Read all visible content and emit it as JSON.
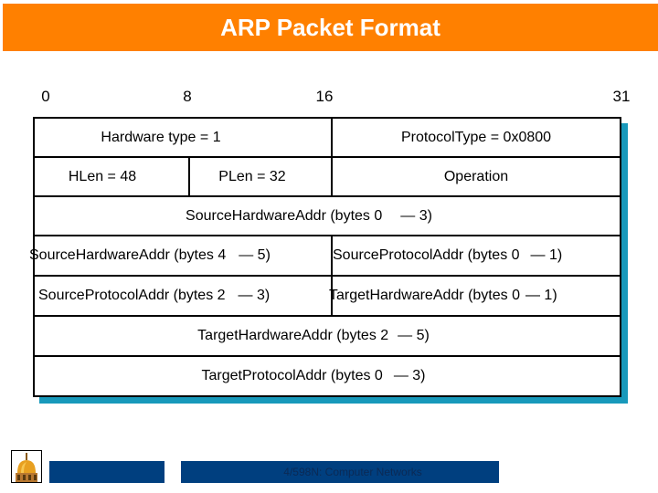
{
  "title": "ARP Packet Format",
  "bit_positions": [
    {
      "label": "0"
    },
    {
      "label": "8"
    },
    {
      "label": "16"
    },
    {
      "label": "31"
    }
  ],
  "rows": [
    {
      "cells": [
        {
          "text": "Hardware type = 1",
          "span_bits": 16
        },
        {
          "text": "ProtocolType = 0x0800",
          "span_bits": 16
        }
      ]
    },
    {
      "cells": [
        {
          "text": "HLen = 48",
          "span_bits": 8
        },
        {
          "text": "PLen = 32",
          "span_bits": 8
        },
        {
          "text": "Operation",
          "span_bits": 16
        }
      ]
    },
    {
      "cells": [
        {
          "text": "SourceHardwareAddr (bytes 0",
          "range_end": "— 3)",
          "span_bits": 32
        }
      ]
    },
    {
      "cells": [
        {
          "text": "SourceHardwareAddr (bytes 4",
          "range_end": "— 5)",
          "span_bits": 16
        },
        {
          "text": "SourceProtocolAddr (bytes 0",
          "range_end": "—  1)",
          "span_bits": 16
        }
      ]
    },
    {
      "cells": [
        {
          "text": "SourceProtocolAddr (bytes 2",
          "range_end": "— 3)",
          "span_bits": 16
        },
        {
          "text": "TargetHardwareAddr (bytes 0",
          "range_end": "— 1)",
          "span_bits": 16
        }
      ]
    },
    {
      "cells": [
        {
          "text": "TargetHardwareAddr (bytes 2",
          "range_end": "—  5)",
          "span_bits": 32
        }
      ]
    },
    {
      "cells": [
        {
          "text": "TargetProtocolAddr (bytes 0",
          "range_end": "— 3)",
          "span_bits": 32
        }
      ]
    }
  ],
  "colors": {
    "title_bar": "#ff8000",
    "shadow": "#1899bb",
    "footer_bar": "#003f7f"
  },
  "footer": {
    "logo_icon": "golden-dome-icon",
    "course_label": "4/598N: Computer Networks"
  }
}
